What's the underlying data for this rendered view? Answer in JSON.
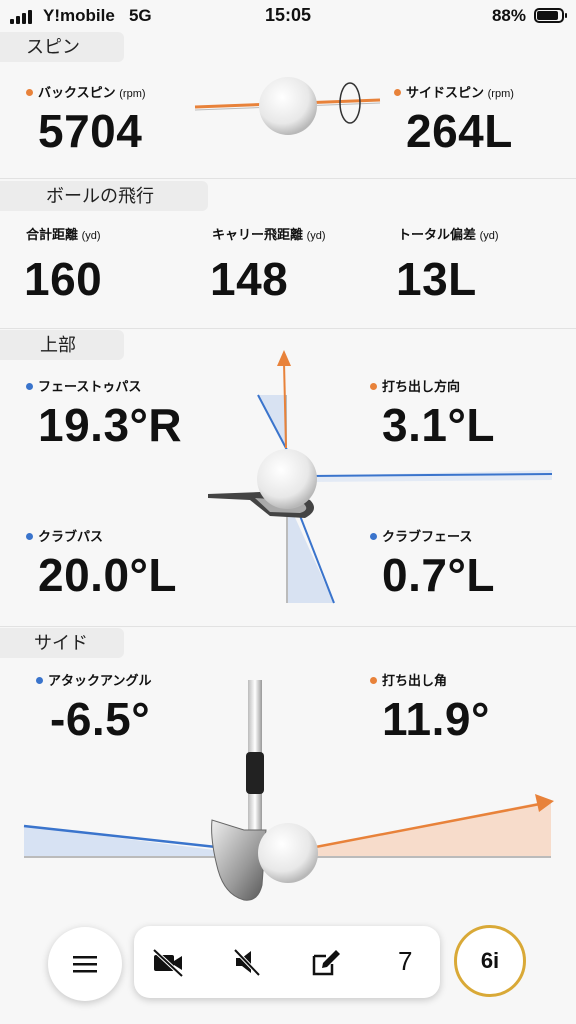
{
  "status_bar": {
    "carrier": "Y!mobile",
    "network": "5G",
    "time": "15:05",
    "battery": "88%"
  },
  "spin": {
    "title": "スピン",
    "backspin": {
      "label": "バックスピン",
      "unit": "(rpm)",
      "value": "5704"
    },
    "sidespin": {
      "label": "サイドスピン",
      "unit": "(rpm)",
      "value": "264L"
    }
  },
  "flight": {
    "title": "ボールの飛行",
    "total": {
      "label": "合計距離",
      "unit": "(yd)",
      "value": "160"
    },
    "carry": {
      "label": "キャリー飛距離",
      "unit": "(yd)",
      "value": "148"
    },
    "deviation": {
      "label": "トータル偏差",
      "unit": "(yd)",
      "value": "13L"
    }
  },
  "top": {
    "title": "上部",
    "face_to_path": {
      "label": "フェーストゥパス",
      "value": "19.3°R"
    },
    "launch_direction": {
      "label": "打ち出し方向",
      "value": "3.1°L"
    },
    "club_path": {
      "label": "クラブパス",
      "value": "20.0°L"
    },
    "club_face": {
      "label": "クラブフェース",
      "value": "0.7°L"
    }
  },
  "side": {
    "title": "サイド",
    "attack_angle": {
      "label": "アタックアングル",
      "value": "-6.5°"
    },
    "launch_angle": {
      "label": "打ち出し角",
      "value": "11.9°"
    }
  },
  "toolbar": {
    "shot_count": "7",
    "club": "6i"
  },
  "icons": [
    "menu-icon",
    "video-off-icon",
    "sound-off-icon",
    "edit-icon"
  ],
  "colors": {
    "orange": "#e8823a",
    "blue": "#3a74cc",
    "club_ring": "#d9a937"
  }
}
